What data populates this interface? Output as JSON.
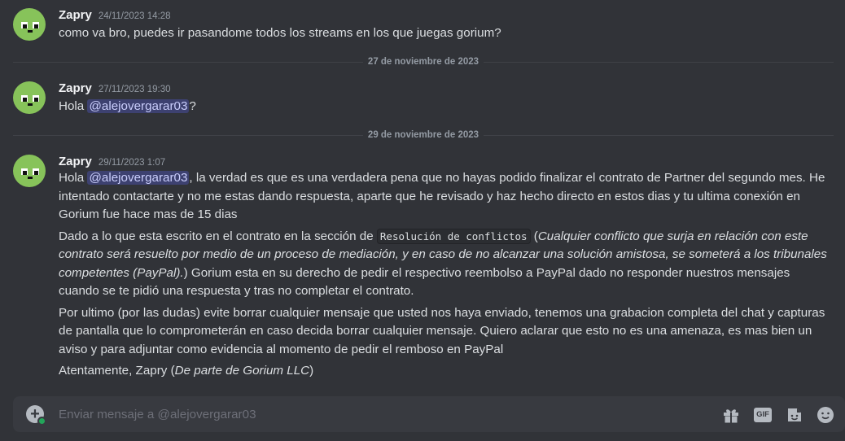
{
  "messages": [
    {
      "username": "Zapry",
      "timestamp": "24/11/2023 14:28",
      "text": "como va bro, puedes ir pasandome todos los streams en los que juegas gorium?"
    },
    {
      "username": "Zapry",
      "timestamp": "27/11/2023 19:30",
      "pre": "Hola ",
      "mention": "@alejovergarar03",
      "post": "?"
    },
    {
      "username": "Zapry",
      "timestamp": "29/11/2023 1:07",
      "p1_pre": "Hola ",
      "p1_mention": "@alejovergarar03",
      "p1_rest": ", la verdad es que es una verdadera pena que no hayas podido finalizar el contrato de Partner del segundo mes. He intentado contactarte y no me estas dando respuesta, aparte que he revisado y haz hecho directo en estos dias y tu ultima conexión en Gorium fue hace mas de 15 dias",
      "p2_pre": "Dado a lo que esta escrito en el contrato en la sección de ",
      "p2_code": "Resolución de conflictos",
      "p2_open": " (",
      "p2_italic": "Cualquier conflicto que surja en relación con este contrato será resuelto por medio de un proceso de mediación, y en caso de no alcanzar una solución amistosa, se someterá a los tribunales competentes (PayPal).",
      "p2_rest": ") Gorium esta en su derecho de pedir el respectivo reembolso a PayPal dado no responder nuestros mensajes cuando se te pidió una respuesta y tras no completar el contrato.",
      "p3": "Por ultimo (por las dudas) evite borrar cualquier mensaje que usted nos haya enviado, tenemos una grabacion completa del chat y capturas de pantalla que lo comprometerán en caso decida borrar cualquier mensaje. Quiero aclarar que esto no es una amenaza, es mas bien un aviso y para adjuntar como evidencia al momento de pedir el remboso en PayPal",
      "p4_pre": "Atentamente, Zapry (",
      "p4_italic": "De parte de Gorium LLC",
      "p4_post": ")"
    }
  ],
  "dividers": [
    "27 de noviembre de 2023",
    "29 de noviembre de 2023"
  ],
  "composer": {
    "placeholder": "Enviar mensaje a @alejovergarar03",
    "gif_label": "GIF"
  },
  "icons": {
    "attach": "plus-circle-icon",
    "gift": "gift-icon",
    "gif": "gif-icon",
    "sticker": "sticker-icon",
    "emoji": "emoji-icon"
  },
  "colors": {
    "background": "#313338",
    "avatar": "#87c35a",
    "mention_bg": "#3c4270",
    "mention_text": "#c9cdfb"
  }
}
